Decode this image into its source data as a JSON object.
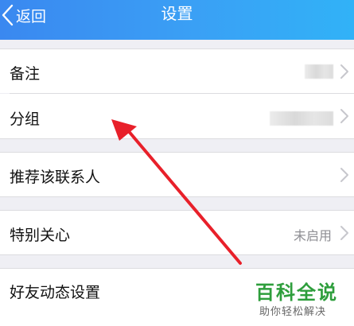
{
  "navbar": {
    "back_label": "返回",
    "title": "设置"
  },
  "rows": [
    {
      "label": "备注"
    },
    {
      "label": "分组"
    },
    {
      "label": "推荐该联系人"
    },
    {
      "label": "特别关心",
      "value": "未启用"
    },
    {
      "label": "好友动态设置"
    }
  ],
  "watermark": {
    "main": "百科全说",
    "sub": "助你轻松解决"
  },
  "colors": {
    "navbar_start": "#3a88f0",
    "navbar_end": "#31b2f7",
    "background": "#efeff4",
    "annotation_arrow": "#e8202a",
    "watermark": "#2e9e3c"
  }
}
